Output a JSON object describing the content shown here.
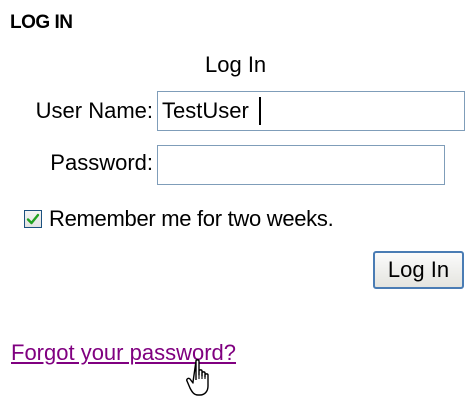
{
  "header": {
    "section_title": "LOG IN"
  },
  "login_form": {
    "title": "Log In",
    "username_label": "User Name:",
    "username_value": "TestUser",
    "password_label": "Password:",
    "password_value": "",
    "remember_label": "Remember me for two weeks.",
    "remember_checked": true,
    "submit_label": "Log In",
    "forgot_link": "Forgot your password?"
  },
  "icons": {
    "checkbox_mark": "checkmark-icon",
    "cursor": "hand-pointer-icon"
  },
  "colors": {
    "link_visited": "#800080",
    "input_border": "#7f9db9",
    "button_border": "#4a7cb4",
    "checkmark": "#21a121"
  }
}
